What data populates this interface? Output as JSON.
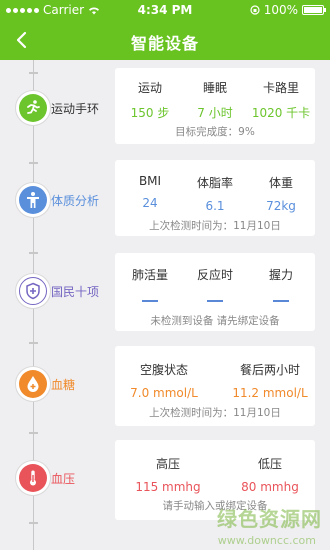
{
  "status_bar": {
    "carrier": "Carrier",
    "time": "4:34 PM",
    "battery": "100%"
  },
  "nav": {
    "title": "智能设备"
  },
  "sections": [
    {
      "label": "运动手环",
      "color": "#6cc52d",
      "metrics": [
        {
          "name": "运动",
          "value": "150 步"
        },
        {
          "name": "睡眠",
          "value": "7 小时"
        },
        {
          "name": "卡路里",
          "value": "1020 千卡"
        }
      ],
      "note": "目标完成度：9%"
    },
    {
      "label": "体质分析",
      "color": "#5a8fdc",
      "metrics": [
        {
          "name": "BMI",
          "value": "24"
        },
        {
          "name": "体脂率",
          "value": "6.1"
        },
        {
          "name": "体重",
          "value": "72kg"
        }
      ],
      "note": "上次检测时间为：11月10日"
    },
    {
      "label": "国民十项",
      "color": "#7466c2",
      "metrics": [
        {
          "name": "肺活量"
        },
        {
          "name": "反应时"
        },
        {
          "name": "握力"
        }
      ],
      "note": "未检测到设备  请先绑定设备"
    },
    {
      "label": "血糖",
      "color": "#f08a2b",
      "metrics": [
        {
          "name": "空腹状态",
          "value": "7.0 mmol/L"
        },
        {
          "name": "餐后两小时",
          "value": "11.2 mmol/L"
        }
      ],
      "note": "上次检测时间为：11月10日"
    },
    {
      "label": "血压",
      "color": "#e9545a",
      "metrics": [
        {
          "name": "高压",
          "value": "115 mmhg"
        },
        {
          "name": "低压",
          "value": "80 mmhg"
        }
      ],
      "note": "请手动输入或绑定设备"
    }
  ],
  "watermark": {
    "line1": "绿色资源网",
    "line2": "www.downcc.com"
  }
}
